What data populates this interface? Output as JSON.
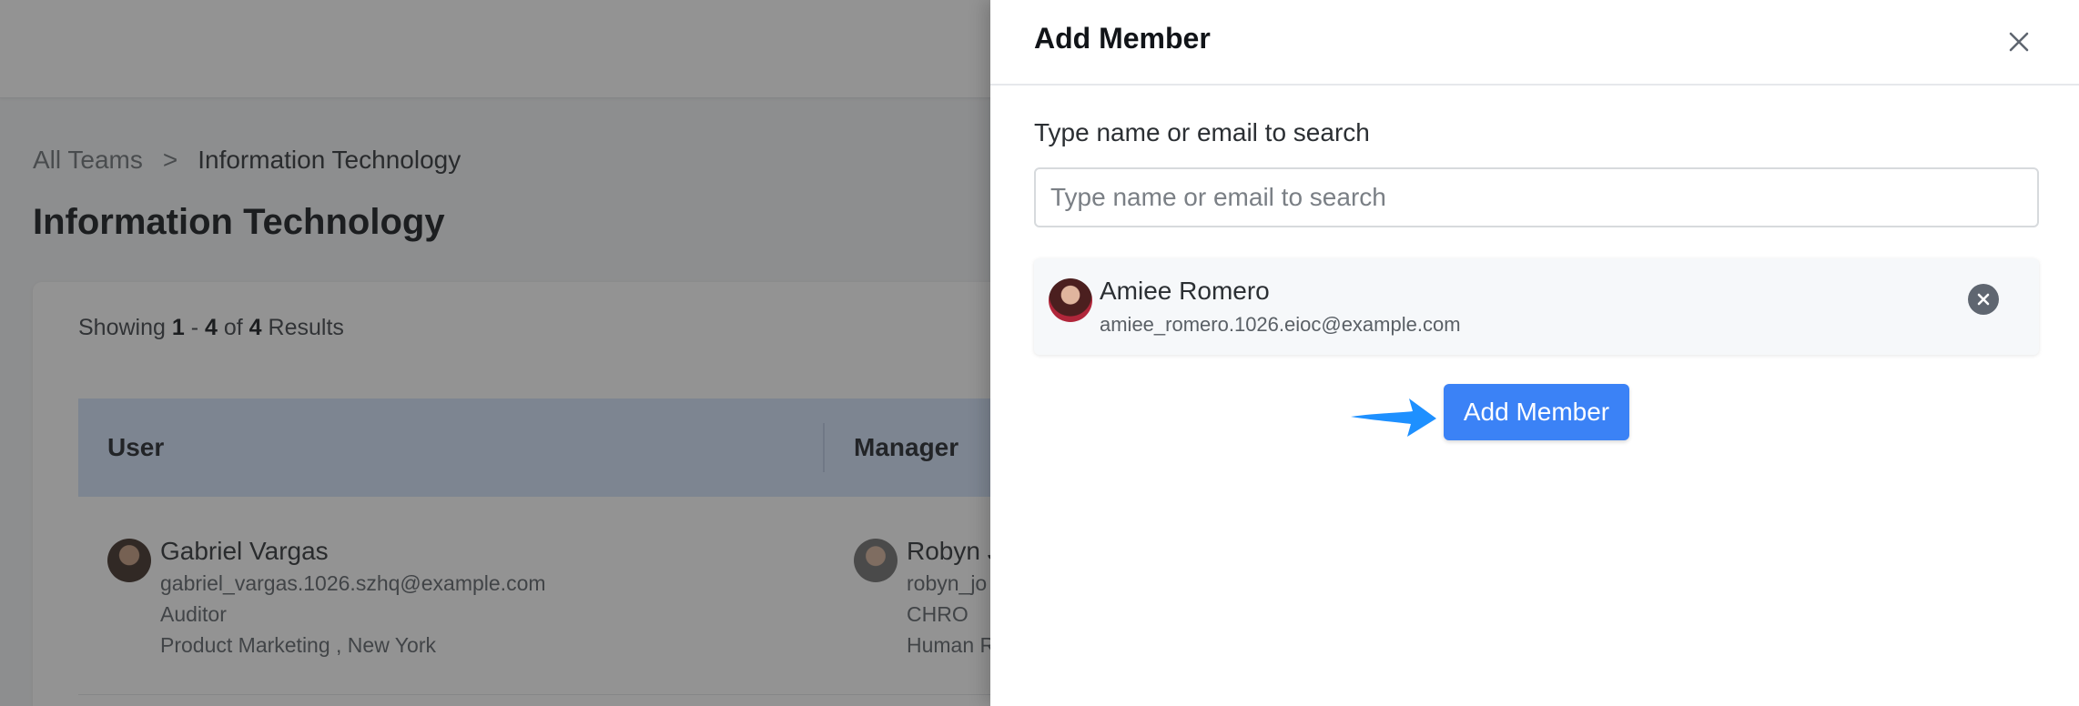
{
  "breadcrumb": {
    "root": "All Teams",
    "separator": ">",
    "current": "Information Technology"
  },
  "page": {
    "title": "Information Technology"
  },
  "results": {
    "prefix": "Showing",
    "start": "1",
    "dash": "-",
    "end": "4",
    "of": "of",
    "total": "4",
    "suffix": "Results"
  },
  "table": {
    "columns": [
      "User",
      "Manager"
    ],
    "rows": [
      {
        "user": {
          "name": "Gabriel Vargas",
          "email": "gabriel_vargas.1026.szhq@example.com",
          "title": "Auditor",
          "location": "Product Marketing , New York"
        },
        "manager": {
          "name": "Robyn J",
          "email": "robyn_jo",
          "title": "CHRO",
          "location": "Human R"
        }
      }
    ]
  },
  "drawer": {
    "title": "Add Member",
    "close_icon": "close-icon",
    "search_label": "Type name or email to search",
    "search_placeholder": "Type name or email to search",
    "search_value": "",
    "selected": {
      "name": "Amiee Romero",
      "email": "amiee_romero.1026.eioc@example.com",
      "remove_icon": "remove-circle-icon"
    },
    "pointer_icon": "arrow-right-icon",
    "add_button": "Add Member"
  },
  "colors": {
    "accent": "#3b82f6",
    "table_header": "#d3e2fb",
    "overlay": "rgba(40,40,40,0.5)",
    "pointer_arrow": "#1e90ff"
  }
}
